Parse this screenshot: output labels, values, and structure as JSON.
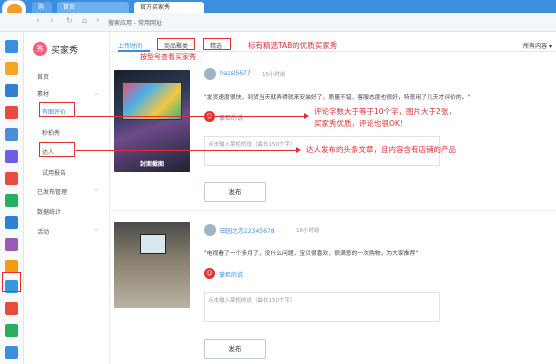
{
  "browser": {
    "tabs": [
      "购物",
      "首页",
      "官方买家秀"
    ],
    "url": "搜索应用 - 常用网址"
  },
  "brand": {
    "badge": "秀",
    "name": "买家秀"
  },
  "nav": {
    "items": [
      {
        "label": "首页",
        "type": "item"
      },
      {
        "label": "素材",
        "type": "group"
      },
      {
        "label": "有图评价",
        "type": "sub"
      },
      {
        "label": "秒拍秀",
        "type": "sub"
      },
      {
        "label": "达人",
        "type": "sub"
      },
      {
        "label": "试用报告",
        "type": "sub"
      },
      {
        "label": "已发布管理",
        "type": "group"
      },
      {
        "label": "数据统计",
        "type": "item"
      },
      {
        "label": "活动",
        "type": "group"
      }
    ]
  },
  "subtabs": {
    "items": [
      "上传时间",
      "商品聚类",
      "精选"
    ],
    "all_content": "所有内容"
  },
  "annotations": {
    "tab_note": "标有精选TAB的优质买家秀",
    "group_note": "按型号查看买家秀",
    "review_note_1": "评论字数大于等于10个字，图片大于2张，",
    "review_note_2": "买家秀优质，评论也很OK！",
    "talent_note": "达人发布的头条文章，且内容含有店铺的产品"
  },
  "posts": [
    {
      "user": "hazsl5677",
      "time": "15小时前",
      "text": "\"发货速度很快，到货当天就弄得就来安装好了，质量不错，客服态度也很好，特意用了几天才评价的。\"",
      "overlay": "封面截图",
      "reply_label": "掌柜的说",
      "placeholder": "点击输入掌柜的说（最长150个字）",
      "send": "发布"
    },
    {
      "user": "田园之恋12345678",
      "time": "16小时前",
      "text": "\"电视看了一个多月了，没什么问题，宝贝很喜欢，很满意的一次购物，为大家推荐\"",
      "overlay": "",
      "reply_label": "掌柜的说",
      "placeholder": "点击输入掌柜的说（最长150个字）",
      "send": "发布"
    }
  ],
  "colors": {
    "accent": "#3c8fe0",
    "annotation": "#e03030"
  }
}
